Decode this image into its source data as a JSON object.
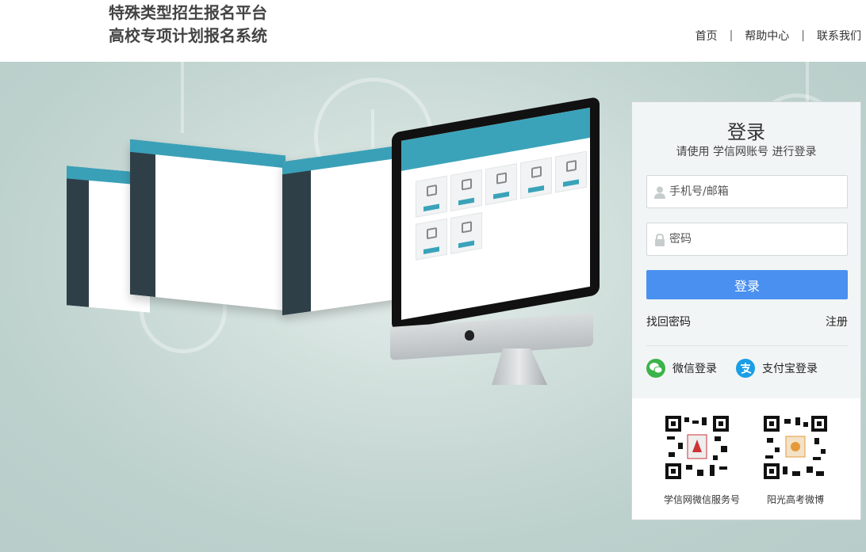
{
  "header": {
    "title_line1": "特殊类型招生报名平台",
    "title_line2": "高校专项计划报名系统",
    "nav": [
      {
        "label": "首页"
      },
      {
        "label": "帮助中心"
      },
      {
        "label": "联系我们"
      }
    ],
    "separator": "|"
  },
  "login": {
    "title": "登录",
    "subtitle": "请使用 学信网账号 进行登录",
    "username_placeholder": "手机号/邮箱",
    "password_placeholder": "密码",
    "submit_label": "登录",
    "forgot_label": "找回密码",
    "register_label": "注册",
    "wechat_label": "微信登录",
    "alipay_label": "支付宝登录"
  },
  "qr": [
    {
      "label": "学信网微信服务号"
    },
    {
      "label": "阳光高考微博"
    }
  ],
  "colors": {
    "accent": "#4a90f0",
    "wechat": "#3bb44a",
    "alipay": "#1a9ee6",
    "screen_header": "#3aa3b9"
  },
  "icons": {
    "username": "user-icon",
    "password": "lock-icon",
    "wechat": "wechat-icon",
    "alipay": "alipay-icon"
  }
}
